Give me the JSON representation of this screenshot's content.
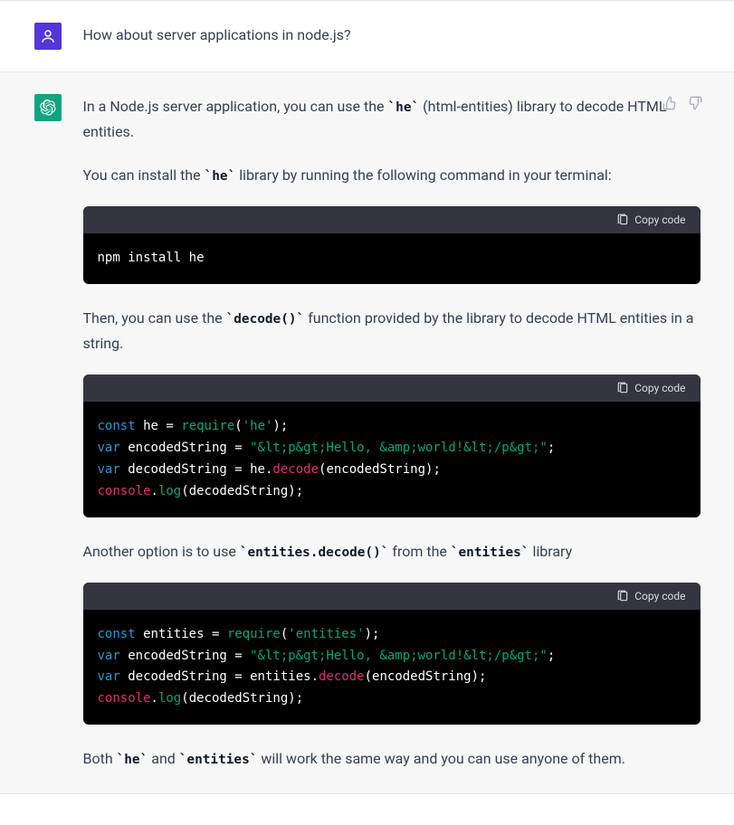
{
  "user": {
    "text": "How about server applications in node.js?"
  },
  "assistant": {
    "p1": {
      "a": "In a Node.js server application, you can use the ",
      "code": "`he`",
      "b": " (html-entities) library to decode HTML entities."
    },
    "p2": {
      "a": "You can install the ",
      "code": "`he`",
      "b": " library by running the following command in your terminal:"
    },
    "p3": {
      "a": "Then, you can use the ",
      "code": "`decode()`",
      "b": " function provided by the library to decode HTML entities in a string."
    },
    "p4": {
      "a": "Another option is to use ",
      "code1": "`entities.decode()`",
      "mid": " from the ",
      "code2": "`entities`",
      "b": " library"
    },
    "p5": {
      "a": "Both ",
      "code1": "`he`",
      "mid": " and ",
      "code2": "`entities`",
      "b": " will work the same way and you can use anyone of them."
    }
  },
  "copy_label": "Copy code",
  "code1": {
    "plain": "npm install he"
  },
  "code2": {
    "l1": {
      "kw": "const",
      "sp1": " ",
      "id": "he",
      "sp2": " ",
      "eq": "=",
      "sp3": " ",
      "req": "require",
      "op1": "(",
      "str": "'he'",
      "op2": ");"
    },
    "l2": {
      "kw": "var",
      "sp1": " ",
      "id": "encodedString",
      "sp2": " ",
      "eq": "=",
      "sp3": " ",
      "str": "\"&lt;p&gt;Hello, &amp;world!&lt;/p&gt;\"",
      "op": ";"
    },
    "l3": {
      "kw": "var",
      "sp1": " ",
      "id": "decodedString",
      "sp2": " ",
      "eq": "=",
      "sp3": " ",
      "obj": "he",
      "dot": ".",
      "call": "decode",
      "op1": "(",
      "arg": "encodedString",
      "op2": ");"
    },
    "l4": {
      "obj": "console",
      "dot": ".",
      "call": "log",
      "op1": "(",
      "arg": "decodedString",
      "op2": ");"
    }
  },
  "code3": {
    "l1": {
      "kw": "const",
      "sp1": " ",
      "id": "entities",
      "sp2": " ",
      "eq": "=",
      "sp3": " ",
      "req": "require",
      "op1": "(",
      "str": "'entities'",
      "op2": ");"
    },
    "l2": {
      "kw": "var",
      "sp1": " ",
      "id": "encodedString",
      "sp2": " ",
      "eq": "=",
      "sp3": " ",
      "str": "\"&lt;p&gt;Hello, &amp;world!&lt;/p&gt;\"",
      "op": ";"
    },
    "l3": {
      "kw": "var",
      "sp1": " ",
      "id": "decodedString",
      "sp2": " ",
      "eq": "=",
      "sp3": " ",
      "obj": "entities",
      "dot": ".",
      "call": "decode",
      "op1": "(",
      "arg": "encodedString",
      "op2": ");"
    },
    "l4": {
      "obj": "console",
      "dot": ".",
      "call": "log",
      "op1": "(",
      "arg": "decodedString",
      "op2": ");"
    }
  }
}
